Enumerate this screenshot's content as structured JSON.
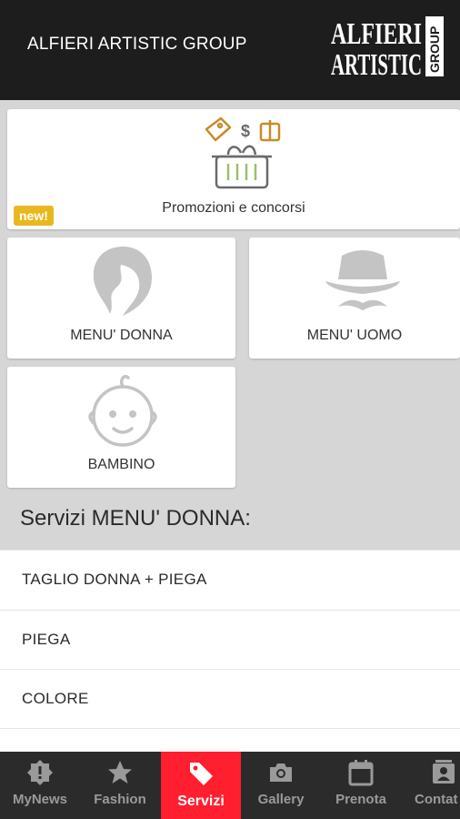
{
  "header": {
    "title": "ALFIERI ARTISTIC GROUP",
    "logo_line1": "ALFIERI",
    "logo_line2": "ARTISTIC",
    "logo_side": "GROUP"
  },
  "cards": {
    "promo": {
      "label": "Promozioni e concorsi",
      "badge": "new!",
      "icon": "shopping-basket-icon"
    },
    "donna": {
      "label": "MENU' DONNA",
      "icon": "woman-head-icon"
    },
    "uomo": {
      "label": "MENU' UOMO",
      "icon": "man-hat-mustache-icon"
    },
    "bambino": {
      "label": "BAMBINO",
      "icon": "baby-face-icon"
    }
  },
  "section": {
    "title": "Servizi MENU' DONNA:"
  },
  "services": [
    {
      "label": "TAGLIO DONNA + PIEGA"
    },
    {
      "label": "PIEGA"
    },
    {
      "label": "COLORE"
    }
  ],
  "tabs": [
    {
      "label": "MyNews",
      "icon": "badge-icon"
    },
    {
      "label": "Fashion",
      "icon": "star-icon"
    },
    {
      "label": "Servizi",
      "icon": "tag-icon",
      "active": true
    },
    {
      "label": "Gallery",
      "icon": "camera-icon"
    },
    {
      "label": "Prenota",
      "icon": "calendar-icon"
    },
    {
      "label": "Contat",
      "icon": "contact-icon"
    }
  ],
  "colors": {
    "header": "#1d1d1d",
    "active_tab": "#ff1f2e",
    "badge": "#e9b81f",
    "icon_gray": "#c4c4c4"
  }
}
